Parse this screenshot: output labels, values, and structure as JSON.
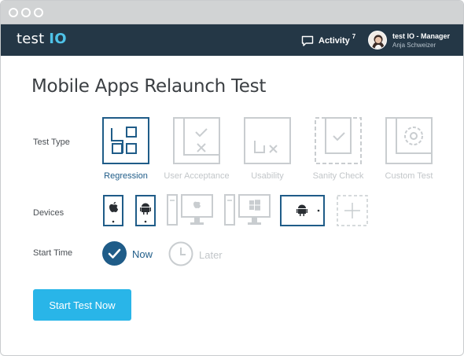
{
  "app": {
    "logo_text": "test",
    "logo_accent": "IO"
  },
  "header": {
    "activity_label": "Activity",
    "activity_count": "7",
    "user_title": "test IO - Manager",
    "user_name": "Anja Schweizer"
  },
  "page_title": "Mobile Apps Relaunch Test",
  "test_type": {
    "label": "Test Type",
    "options": [
      {
        "label": "Regression",
        "selected": true,
        "icon": "regression-grid-icon"
      },
      {
        "label": "User Acceptance",
        "selected": false,
        "icon": "user-acceptance-icon"
      },
      {
        "label": "Usability",
        "selected": false,
        "icon": "usability-icon"
      },
      {
        "label": "Sanity Check",
        "selected": false,
        "icon": "sanity-check-icon"
      },
      {
        "label": "Custom Test",
        "selected": false,
        "icon": "custom-test-gear-icon"
      }
    ]
  },
  "devices": {
    "label": "Devices",
    "options": [
      {
        "name": "iOS phone",
        "selected": true,
        "icon": "apple-phone-icon"
      },
      {
        "name": "Android phone",
        "selected": true,
        "icon": "android-phone-icon"
      },
      {
        "name": "Mac desktop",
        "selected": false,
        "icon": "apple-desktop-icon"
      },
      {
        "name": "Windows desktop",
        "selected": false,
        "icon": "windows-desktop-icon"
      },
      {
        "name": "Android tablet",
        "selected": true,
        "icon": "android-tablet-icon"
      },
      {
        "name": "Add device",
        "selected": false,
        "icon": "plus-icon"
      }
    ]
  },
  "start_time": {
    "label": "Start Time",
    "now_label": "Now",
    "later_label": "Later",
    "selected": "now"
  },
  "start_button_label": "Start Test Now",
  "colors": {
    "navbar": "#243746",
    "active": "#1f5c88",
    "inactive": "#c2c6c9",
    "primary_button": "#29b5e8",
    "logo_accent": "#4fc3e8"
  }
}
